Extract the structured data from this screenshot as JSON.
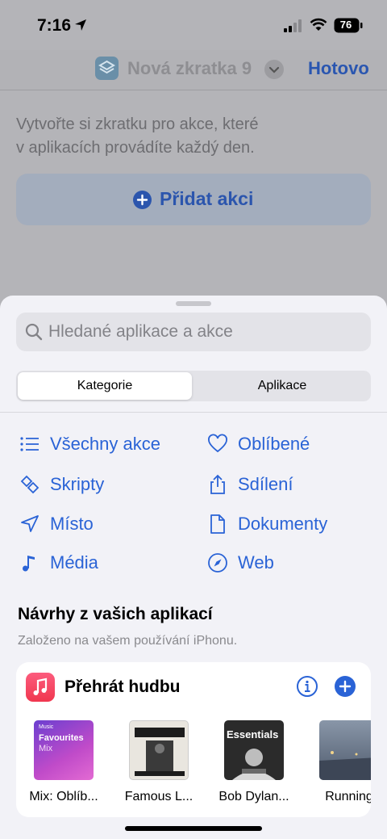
{
  "status_bar": {
    "time": "7:16",
    "battery": "76"
  },
  "nav": {
    "shortcut_title": "Nová zkratka 9",
    "done_label": "Hotovo"
  },
  "editor": {
    "intro_line1": "Vytvořte si zkratku pro akce, které",
    "intro_line2": "v aplikacích provádíte každý den.",
    "add_action_label": "Přidat akci"
  },
  "sheet": {
    "search_placeholder": "Hledané aplikace a akce",
    "segments": [
      "Kategorie",
      "Aplikace"
    ],
    "categories": [
      {
        "label": "Všechny akce",
        "icon": "list-icon"
      },
      {
        "label": "Oblíbené",
        "icon": "heart-icon"
      },
      {
        "label": "Skripty",
        "icon": "scripts-icon"
      },
      {
        "label": "Sdílení",
        "icon": "share-icon"
      },
      {
        "label": "Místo",
        "icon": "location-arrow-icon"
      },
      {
        "label": "Dokumenty",
        "icon": "document-icon"
      },
      {
        "label": "Média",
        "icon": "music-note-icon"
      },
      {
        "label": "Web",
        "icon": "compass-icon"
      }
    ],
    "suggestions_title": "Návrhy z vašich aplikací",
    "suggestions_subtitle": "Založeno na vašem používání iPhonu.",
    "card": {
      "title": "Přehrát hudbu",
      "albums": [
        {
          "label": "Mix: Oblíb...",
          "art_brand": "Music",
          "art_title": "Favourites",
          "art_sub": "Mix"
        },
        {
          "label": "Famous L..."
        },
        {
          "label": "Bob Dylan...",
          "art_title": "Essentials"
        },
        {
          "label": "Running"
        }
      ]
    }
  },
  "colors": {
    "accent": "#2a63d6",
    "sheet_bg": "#f2f2f7",
    "dim_bg": "#b4b4b8"
  }
}
